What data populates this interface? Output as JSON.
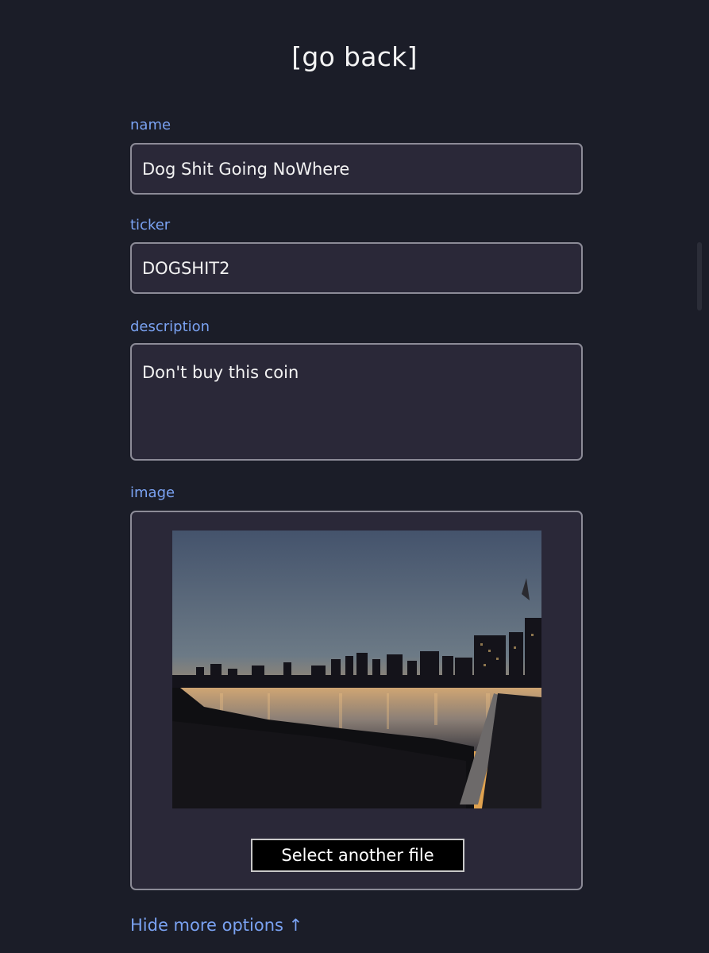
{
  "header": {
    "go_back": "[go back]"
  },
  "form": {
    "name": {
      "label": "name",
      "value": "Dog Shit Going NoWhere"
    },
    "ticker": {
      "label": "ticker",
      "value": "DOGSHIT2"
    },
    "description": {
      "label": "description",
      "value": "Don't buy this coin"
    },
    "image": {
      "label": "image",
      "select_button": "Select another file"
    }
  },
  "footer": {
    "hide_options": "Hide more options ↑"
  },
  "colors": {
    "background": "#1b1d28",
    "field_background": "#2a2838",
    "label_accent": "#7aa2f2"
  }
}
